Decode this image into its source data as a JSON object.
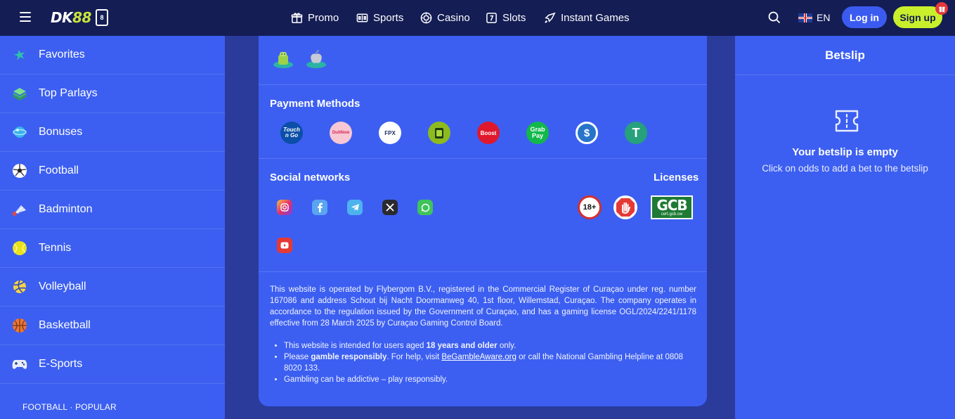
{
  "header": {
    "logo_dk": "DK",
    "logo_88": "88",
    "logo_badge": "8",
    "nav": [
      {
        "label": "Promo",
        "icon": "gift-icon"
      },
      {
        "label": "Sports",
        "icon": "scoreboard-icon"
      },
      {
        "label": "Casino",
        "icon": "chip-icon"
      },
      {
        "label": "Slots",
        "icon": "slot-icon"
      },
      {
        "label": "Instant Games",
        "icon": "rocket-icon"
      }
    ],
    "language": "EN",
    "login_label": "Log in",
    "signup_label": "Sign up"
  },
  "sidebar": {
    "items": [
      {
        "label": "Favorites",
        "icon": "star-icon"
      },
      {
        "label": "Top Parlays",
        "icon": "layers-icon"
      },
      {
        "label": "Bonuses",
        "icon": "bonus-icon"
      },
      {
        "label": "Football",
        "icon": "football-icon"
      },
      {
        "label": "Badminton",
        "icon": "shuttlecock-icon"
      },
      {
        "label": "Tennis",
        "icon": "tennis-ball-icon"
      },
      {
        "label": "Volleyball",
        "icon": "volleyball-icon"
      },
      {
        "label": "Basketball",
        "icon": "basketball-icon"
      },
      {
        "label": "E-Sports",
        "icon": "gamepad-icon"
      }
    ],
    "section_label": "FOOTBALL · POPULAR"
  },
  "footer": {
    "apps": [
      "android-icon",
      "apple-icon"
    ],
    "payment_title": "Payment Methods",
    "payments": [
      {
        "name": "Touch 'n Go",
        "label": "Touch n Go",
        "color": "#0b4fa8"
      },
      {
        "name": "DuitNow",
        "label": "DuitNow",
        "color": "#f7c7d4"
      },
      {
        "name": "FPX",
        "label": "FPX",
        "color": "#ffffff"
      },
      {
        "name": "Paytm wallet",
        "label": "",
        "color": "#8dbb1e"
      },
      {
        "name": "Boost",
        "label": "Boost",
        "color": "#e0182d"
      },
      {
        "name": "GrabPay",
        "label": "Grab Pay",
        "color": "#12b84a"
      },
      {
        "name": "USD Coin",
        "label": "$",
        "color": "#2775ca"
      },
      {
        "name": "Tether",
        "label": "T",
        "color": "#26a17b"
      }
    ],
    "social_title": "Social networks",
    "socials": [
      "instagram-icon",
      "facebook-icon",
      "telegram-icon",
      "x-icon",
      "whatsapp-icon",
      "youtube-icon"
    ],
    "licenses_title": "Licenses",
    "license_18": "18+",
    "license_gcb": "GCB",
    "license_gcb_sub": "cert.gcb.cw",
    "legal_text": "This website is operated by Flybergom B.V., registered in the Commercial Register of Curaçao under reg. number 167086 and address Schout bij Nacht Doormanweg 40, 1st floor, Willemstad, Curaçao. The company operates in accordance to the regulation issued by the Government of Curaçao, and has a gaming license OGL/2024/2241/1178 effective from 28 March 2025 by Curaçao Gaming Control Board.",
    "bullet1_pre": "This website is intended for users aged ",
    "bullet1_bold": "18 years and older",
    "bullet1_post": " only.",
    "bullet2_pre": "Please ",
    "bullet2_bold": "gamble responsibly",
    "bullet2_mid": ". For help, visit ",
    "bullet2_link": "BeGambleAware.org",
    "bullet2_post": " or call the National Gambling Helpline at 0808 8020 133.",
    "bullet3": "Gambling can be addictive – play responsibly."
  },
  "betslip": {
    "title": "Betslip",
    "empty_title": "Your betslip is empty",
    "empty_hint": "Click on odds to add a bet to the betslip"
  },
  "colors": {
    "header_bg": "#141d54",
    "panel_bg": "#3c5ff1",
    "page_bg": "#2a3b9b",
    "accent_lime": "#c9ef2c"
  }
}
